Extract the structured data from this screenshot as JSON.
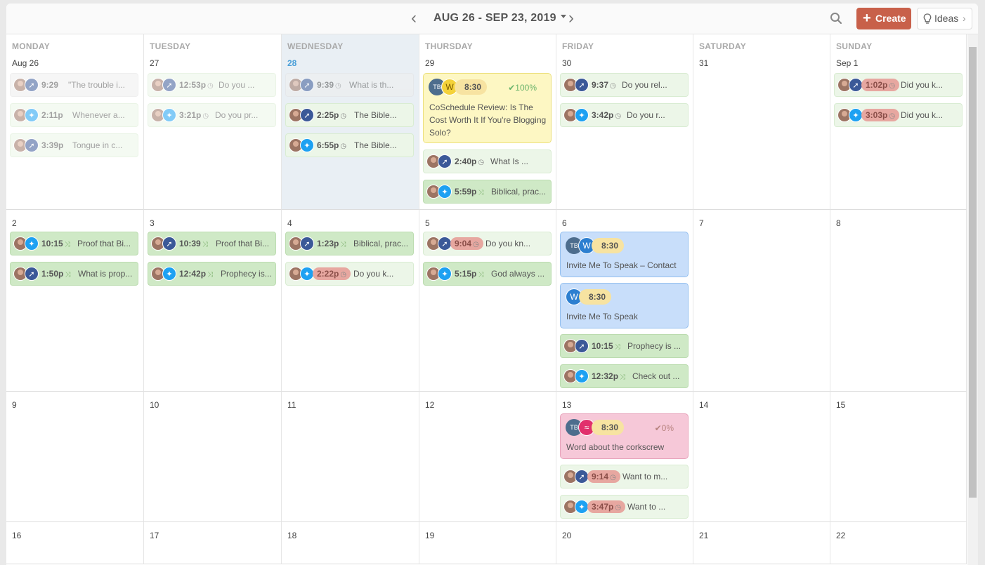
{
  "header": {
    "date_range": "AUG 26 - SEP 23, 2019",
    "prev_label": "‹",
    "next_label": "›",
    "create_label": "Create",
    "ideas_label": "Ideas"
  },
  "weekdays": [
    "MONDAY",
    "TUESDAY",
    "WEDNESDAY",
    "THURSDAY",
    "FRIDAY",
    "SATURDAY",
    "SUNDAY"
  ],
  "weeks": [
    [
      "Aug 26",
      "27",
      "28",
      "29",
      "30",
      "31",
      "Sep 1"
    ],
    [
      "2",
      "3",
      "4",
      "5",
      "6",
      "7",
      "8"
    ],
    [
      "9",
      "10",
      "11",
      "12",
      "13",
      "14",
      "15"
    ],
    [
      "16",
      "17",
      "18",
      "19",
      "20",
      "21",
      "22"
    ]
  ],
  "colors": {
    "create": "#c8604a",
    "today": "#4a9fd8",
    "twitter": "#1da1f2",
    "facebook": "#3b5998"
  },
  "posts": {
    "mon26": [
      {
        "time": "9:29",
        "text": "\"The trouble i..."
      },
      {
        "time": "2:11p",
        "text": "Whenever a..."
      },
      {
        "time": "3:39p",
        "text": "Tongue in c..."
      }
    ],
    "tue27": [
      {
        "time": "12:53p",
        "text": "Do you ..."
      },
      {
        "time": "3:21p",
        "text": "Do you pr..."
      }
    ],
    "wed28": [
      {
        "time": "9:39",
        "text": "What is th..."
      },
      {
        "time": "2:25p",
        "text": "The Bible..."
      },
      {
        "time": "6:55p",
        "text": "The Bible..."
      }
    ],
    "thu29": [
      {
        "time": "2:40p",
        "text": "What Is ..."
      },
      {
        "time": "5:59p",
        "text": "Biblical, prac..."
      }
    ],
    "thu29_big": {
      "avatar": "TB",
      "time": "8:30",
      "status": "100%",
      "title": "CoSchedule Review: Is The Cost Worth It If You're Blogging Solo?"
    },
    "fri30": [
      {
        "time": "9:37",
        "text": "Do you rel..."
      },
      {
        "time": "3:42p",
        "text": "Do you r..."
      }
    ],
    "sun1": [
      {
        "time": "1:02p",
        "text": "Did you k..."
      },
      {
        "time": "3:03p",
        "text": "Did you k..."
      }
    ],
    "mon2": [
      {
        "time": "10:15",
        "text": "Proof that Bi..."
      },
      {
        "time": "1:50p",
        "text": "What is prop..."
      }
    ],
    "tue3": [
      {
        "time": "10:39",
        "text": "Proof that Bi..."
      },
      {
        "time": "12:42p",
        "text": "Prophecy is..."
      }
    ],
    "wed4": [
      {
        "time": "1:23p",
        "text": "Biblical, prac..."
      },
      {
        "time": "2:22p",
        "text": "Do you k..."
      }
    ],
    "thu5": [
      {
        "time": "9:04",
        "text": "Do you kn..."
      },
      {
        "time": "5:15p",
        "text": "God always ..."
      }
    ],
    "fri6_big1": {
      "avatar": "TB",
      "time": "8:30",
      "title": "Invite Me To Speak – Contact"
    },
    "fri6_big2": {
      "time": "8:30",
      "title": "Invite Me To Speak"
    },
    "fri6": [
      {
        "time": "10:15",
        "text": "Prophecy is ..."
      },
      {
        "time": "12:32p",
        "text": "Check out ..."
      }
    ],
    "fri13_big": {
      "avatar": "TB",
      "time": "8:30",
      "status": "0%",
      "title": "Word about the corkscrew"
    },
    "fri13": [
      {
        "time": "9:14",
        "text": "Want to m..."
      },
      {
        "time": "3:47p",
        "text": "Want to ..."
      }
    ]
  }
}
